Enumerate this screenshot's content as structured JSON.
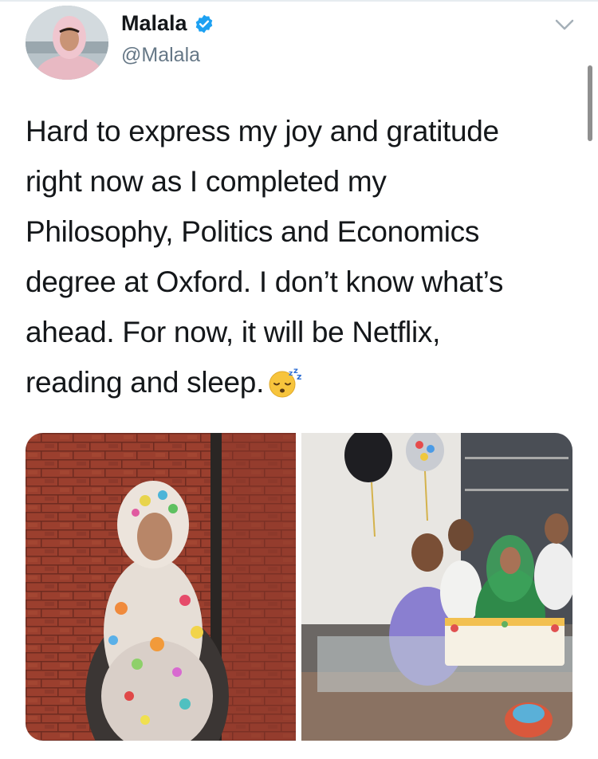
{
  "tweet": {
    "author_name": "Malala",
    "author_handle": "@Malala",
    "verified": true,
    "text_lines": [
      "Hard to express my joy and gratitude",
      "right now as I completed my",
      "Philosophy, Politics and Economics",
      "degree at Oxford. I don’t know what’s",
      "ahead. For now, it will be Netflix,",
      "reading and sleep."
    ],
    "emoji": "sleeping-face",
    "photos": [
      {
        "name": "celebration-photo"
      },
      {
        "name": "family-cake-photo"
      }
    ]
  },
  "colors": {
    "verified": "#1da1f2",
    "text": "#14171a",
    "secondary_text": "#657786",
    "divider": "#e6ecf0"
  },
  "icons": [
    "verified-badge-icon",
    "chevron-down-icon",
    "sleeping-face-emoji"
  ]
}
